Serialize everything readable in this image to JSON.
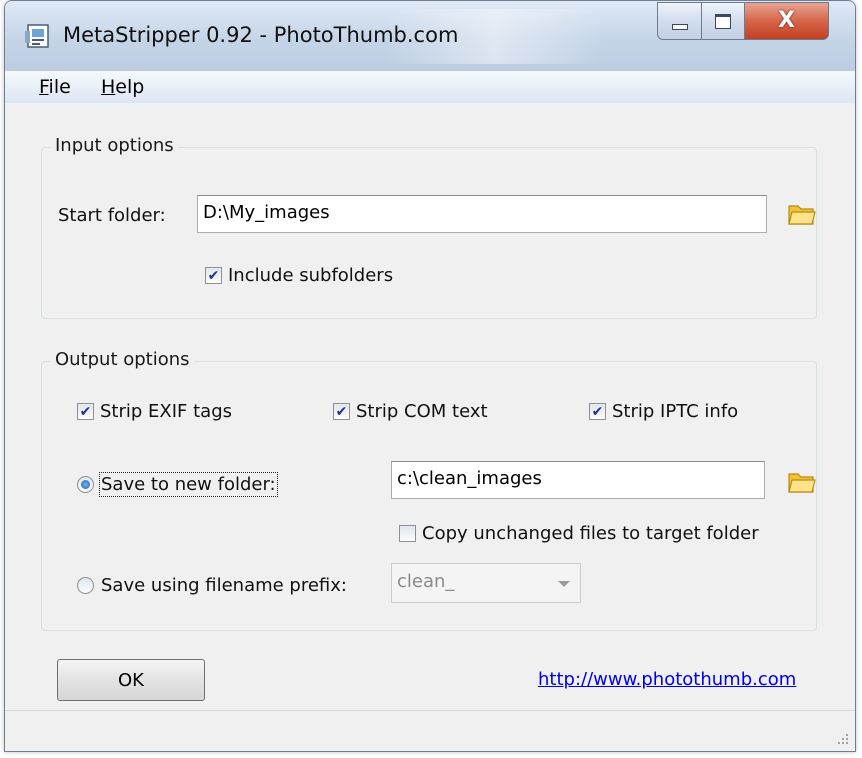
{
  "window": {
    "title": "MetaStripper 0.92 - PhotoThumb.com",
    "controls": {
      "minimize": "minimize-icon",
      "maximize": "maximize-icon",
      "close": "X"
    }
  },
  "menu": {
    "file": "File",
    "help": "Help"
  },
  "input_options": {
    "legend": "Input options",
    "start_folder_label": "Start folder:",
    "start_folder_value": "D:\\My_images",
    "include_subfolders_label": "Include subfolders",
    "include_subfolders_checked": true
  },
  "output_options": {
    "legend": "Output options",
    "strip_exif_label": "Strip EXIF tags",
    "strip_exif_checked": true,
    "strip_com_label": "Strip COM text",
    "strip_com_checked": true,
    "strip_iptc_label": "Strip IPTC info",
    "strip_iptc_checked": true,
    "save_new_folder_label": "Save to new folder:",
    "save_new_folder_selected": true,
    "new_folder_value": "c:\\clean_images",
    "copy_unchanged_label": "Copy unchanged files to target folder",
    "copy_unchanged_checked": false,
    "save_prefix_label": "Save using filename prefix:",
    "save_prefix_selected": false,
    "prefix_value": "clean_"
  },
  "footer": {
    "ok_label": "OK",
    "link_text": "http://www.photothumb.com"
  },
  "colors": {
    "titlebar": "#c5d5e8",
    "close_button": "#d7654a",
    "link": "#0000ee",
    "check_mark": "#21318e"
  }
}
